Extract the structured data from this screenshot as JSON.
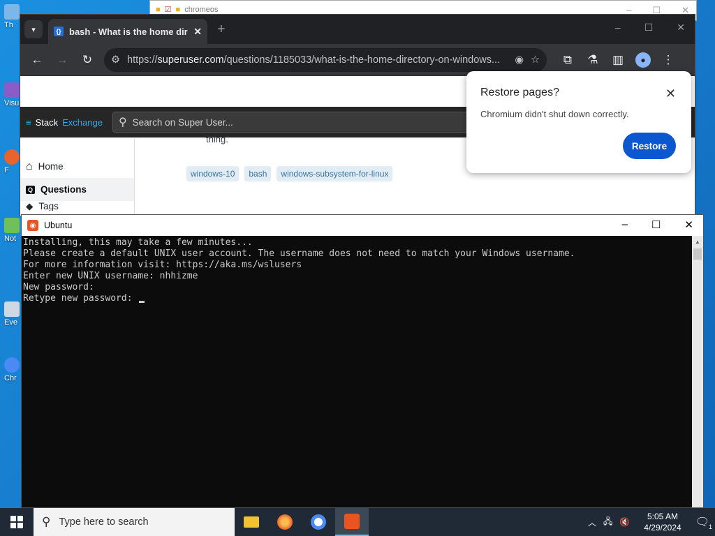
{
  "explorer": {
    "title": "chromeos"
  },
  "desktop_icons": [
    "Th",
    "Visua",
    "F",
    "Not",
    "Eve",
    "Chr"
  ],
  "browser": {
    "tab_title": "bash - What is the home directo",
    "url_prefix": "https://",
    "url_host": "superuser.com",
    "url_path": "/questions/1185033/what-is-the-home-directory-on-windows...",
    "new_tab_label": "+"
  },
  "site": {
    "logo_a": "Stack",
    "logo_b": "Exchange",
    "search_placeholder": "Search on Super User...",
    "snippet": "thing.",
    "nav": [
      {
        "label": "Home"
      },
      {
        "label": "Questions"
      },
      {
        "label": "Tags"
      }
    ],
    "tags": [
      "windows-10",
      "bash",
      "windows-subsystem-for-linux"
    ]
  },
  "restore_popup": {
    "title": "Restore pages?",
    "message": "Chromium didn't shut down correctly.",
    "button": "Restore"
  },
  "terminal": {
    "title": "Ubuntu",
    "lines": [
      "Installing, this may take a few minutes...",
      "Please create a default UNIX user account. The username does not need to match your Windows username.",
      "For more information visit: https://aka.ms/wslusers",
      "Enter new UNIX username: nhhizme",
      "New password:",
      "Retype new password: "
    ]
  },
  "taskbar": {
    "search_placeholder": "Type here to search",
    "time": "5:05 AM",
    "date": "4/29/2024",
    "notification_count": "1"
  }
}
